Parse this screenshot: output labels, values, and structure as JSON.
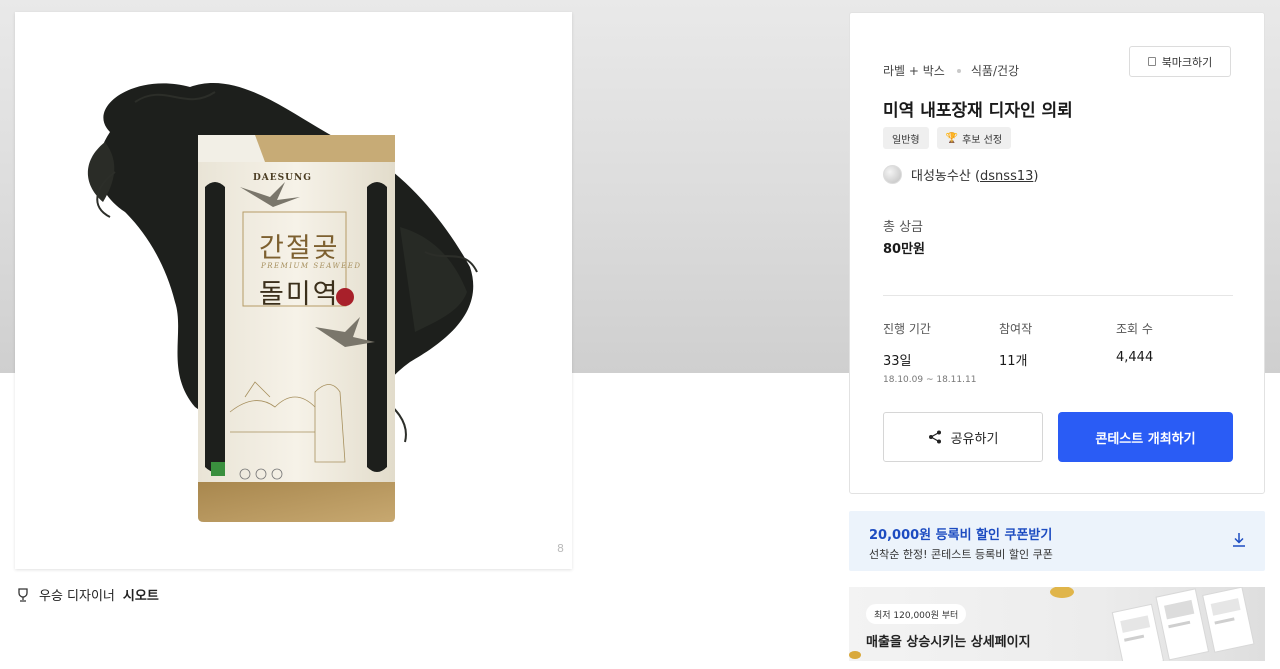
{
  "product_image": {
    "package_brand": "DAESUNG",
    "package_title_line1": "간절곶",
    "package_subtitle": "PREMIUM SEAWEED",
    "package_title_line2": "돌미역",
    "image_index": "8"
  },
  "award": {
    "prefix": "우승 디자이너",
    "name": "시오트"
  },
  "contest": {
    "category": "라벨 + 박스",
    "subcategory": "식품/건강",
    "bookmark_label": "북마크하기",
    "title": "미역 내포장재 디자인 의뢰",
    "badges": [
      "일반형",
      "후보 선정"
    ],
    "owner_name": "대성농수산",
    "owner_open": "(",
    "owner_id": "dsnss13",
    "owner_close": ")",
    "prize_label": "총 상금",
    "prize_value": "80만원",
    "stats": [
      {
        "label": "진행 기간",
        "value": "33일",
        "sub": "18.10.09 ~ 18.11.11"
      },
      {
        "label": "참여작",
        "value": "11개"
      },
      {
        "label": "조회 수",
        "value": "4,444"
      }
    ],
    "share_label": "공유하기",
    "host_label": "콘테스트 개최하기"
  },
  "coupon": {
    "title": "20,000원 등록비 할인 쿠폰받기",
    "subtitle": "선착순 한정! 콘테스트 등록비 할인 쿠폰"
  },
  "promo": {
    "pill": "최저 120,000원 부터",
    "title": "매출을 상승시키는 상세페이지"
  },
  "colors": {
    "accent": "#2a5cf5",
    "coupon_text": "#1d4cc1",
    "coupon_bg": "#ecf3fb"
  }
}
